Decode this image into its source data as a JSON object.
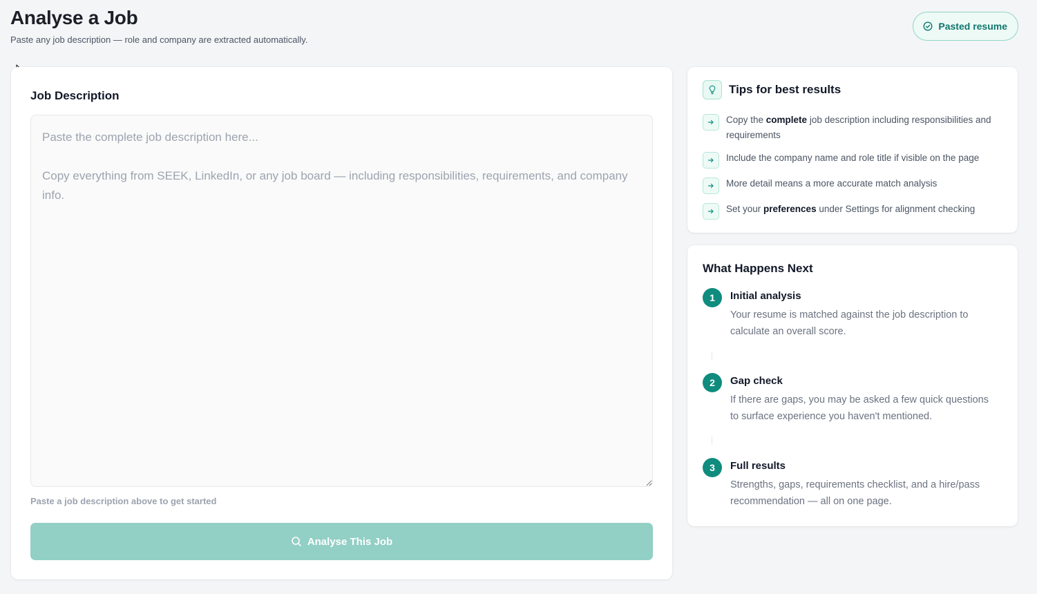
{
  "header": {
    "title": "Analyse a Job",
    "subtitle": "Paste any job description — role and company are extracted automatically."
  },
  "resume_badge": {
    "label": "Pasted resume"
  },
  "job_description": {
    "label": "Job Description",
    "value": "",
    "placeholder": "Paste the complete job description here...\n\nCopy everything from SEEK, LinkedIn, or any job board — including responsibilities, requirements, and company info.",
    "helper": "Paste a job description above to get started"
  },
  "analyse_button": {
    "label": "Analyse This Job",
    "icon": "search-icon",
    "enabled": false
  },
  "tips": {
    "title": "Tips for best results",
    "items": [
      {
        "before": "Copy the ",
        "bold": "complete",
        "after": " job description including responsibilities and requirements"
      },
      {
        "before": "Include the company name and role title if visible on the page",
        "bold": "",
        "after": ""
      },
      {
        "before": "More detail means a more accurate match analysis",
        "bold": "",
        "after": ""
      },
      {
        "before": "Set your ",
        "bold": "preferences",
        "after": " under Settings for alignment checking"
      }
    ]
  },
  "next": {
    "title": "What Happens Next",
    "steps": [
      {
        "number": "1",
        "title": "Initial analysis",
        "desc": "Your resume is matched against the job description to calculate an overall score."
      },
      {
        "number": "2",
        "title": "Gap check",
        "desc": "If there are gaps, you may be asked a few quick questions to surface experience you haven't mentioned."
      },
      {
        "number": "3",
        "title": "Full results",
        "desc": "Strengths, gaps, requirements checklist, and a hire/pass recommendation — all on one page."
      }
    ]
  },
  "colors": {
    "accent": "#0f8c7e",
    "button_disabled": "#92cfc5",
    "badge_bg": "#eefaf6"
  }
}
